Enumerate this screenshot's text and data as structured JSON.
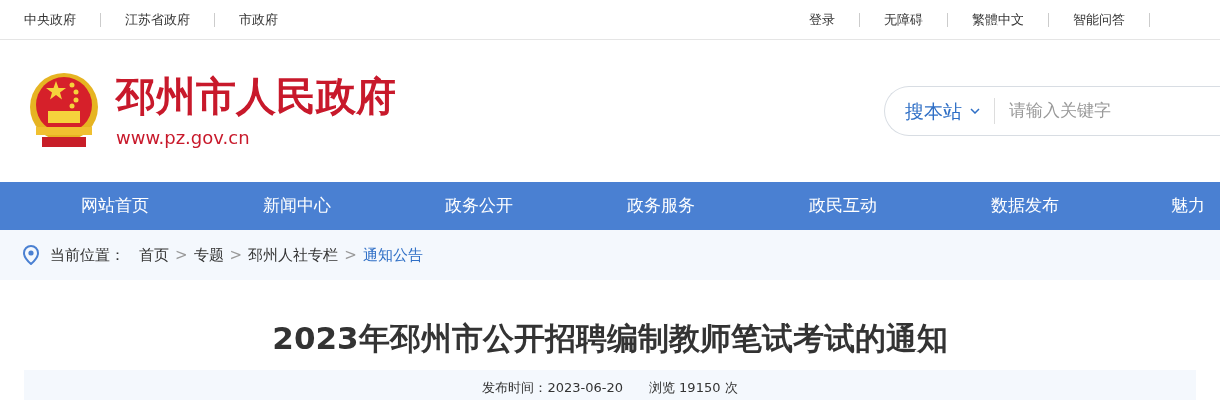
{
  "top_bar": {
    "left_links": [
      "中央政府",
      "江苏省政府",
      "市政府"
    ],
    "right_links": [
      "登录",
      "无障碍",
      "繁體中文",
      "智能问答"
    ]
  },
  "header": {
    "site_name": "邳州市人民政府",
    "site_url": "www.pz.gov.cn",
    "search": {
      "scope": "搜本站",
      "placeholder": "请输入关键字"
    }
  },
  "nav": [
    {
      "label": "网站首页"
    },
    {
      "label": "新闻中心"
    },
    {
      "label": "政务公开"
    },
    {
      "label": "政务服务"
    },
    {
      "label": "政民互动"
    },
    {
      "label": "数据发布"
    },
    {
      "label": "魅力"
    }
  ],
  "breadcrumb": {
    "prefix": "当前位置：",
    "items": [
      {
        "label": "首页",
        "current": false
      },
      {
        "label": "专题",
        "current": false
      },
      {
        "label": "邳州人社专栏",
        "current": false
      },
      {
        "label": "通知公告",
        "current": true
      }
    ],
    "separator": ">"
  },
  "article": {
    "title": "2023年邳州市公开招聘编制教师笔试考试的通知",
    "published": "发布时间：2023-06-20",
    "views": "浏览 19150 次"
  }
}
